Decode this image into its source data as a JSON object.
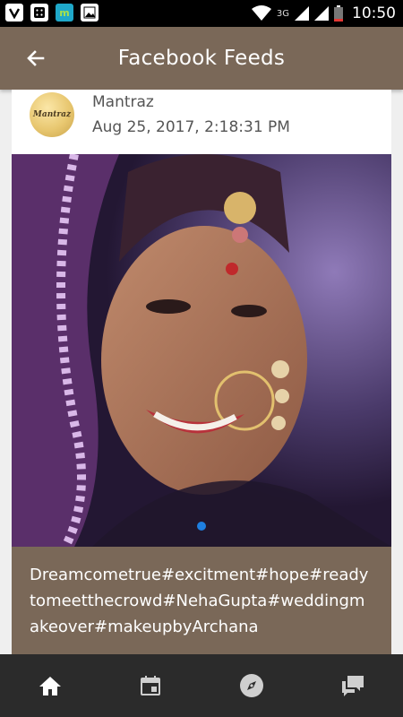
{
  "status_bar": {
    "time": "10:50",
    "network": "3G",
    "apps": [
      {
        "icon": "app-v-icon",
        "label": "V"
      },
      {
        "icon": "app-grid-icon",
        "label": ""
      },
      {
        "icon": "app-m-icon",
        "label": "m"
      },
      {
        "icon": "gallery-icon",
        "label": ""
      }
    ],
    "colors": {
      "m_app": "#1fa8c9"
    }
  },
  "app_bar": {
    "title": "Facebook Feeds",
    "back_icon": "arrow-left-icon"
  },
  "post": {
    "author": "Mantraz",
    "timestamp": "Aug 25, 2017, 2:18:31 PM",
    "avatar_text": "Mantraz",
    "caption": "Dreamcometrue#excitment#hope#readytomeetthecrowd#NehaGupta#weddingmakeover#makeupbyArchana",
    "carousel_active_index": 0
  },
  "bottom_nav": [
    {
      "name": "home",
      "icon": "home-icon",
      "active": true
    },
    {
      "name": "events",
      "icon": "calendar-icon",
      "active": false
    },
    {
      "name": "explore",
      "icon": "compass-icon",
      "active": false
    },
    {
      "name": "messages",
      "icon": "chat-icon",
      "active": false
    }
  ],
  "colors": {
    "brand_brown": "#7a6858",
    "nav_bg": "#2b2b2b",
    "carousel_dot": "#1e7fe0"
  }
}
